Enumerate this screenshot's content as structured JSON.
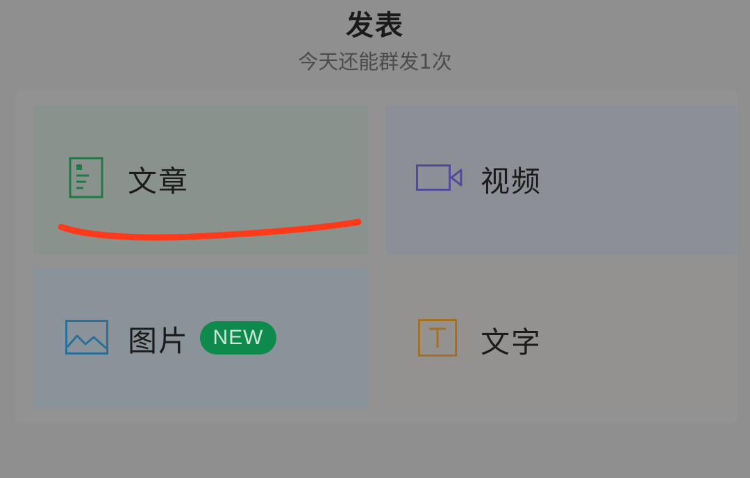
{
  "header": {
    "title": "发表",
    "subtitle": "今天还能群发1次"
  },
  "options": [
    {
      "label": "文章",
      "icon": "article-icon",
      "accent": "#1f7a44"
    },
    {
      "label": "视频",
      "icon": "video-camera-icon",
      "accent": "#4f4a9a"
    },
    {
      "label": "图片",
      "icon": "image-icon",
      "accent": "#2a6f9a",
      "badge": "NEW"
    },
    {
      "label": "文字",
      "icon": "text-icon",
      "accent": "#a56f1f"
    }
  ],
  "colors": {
    "badge": "#0f8a4d",
    "annotation": "#ff3a1a"
  }
}
